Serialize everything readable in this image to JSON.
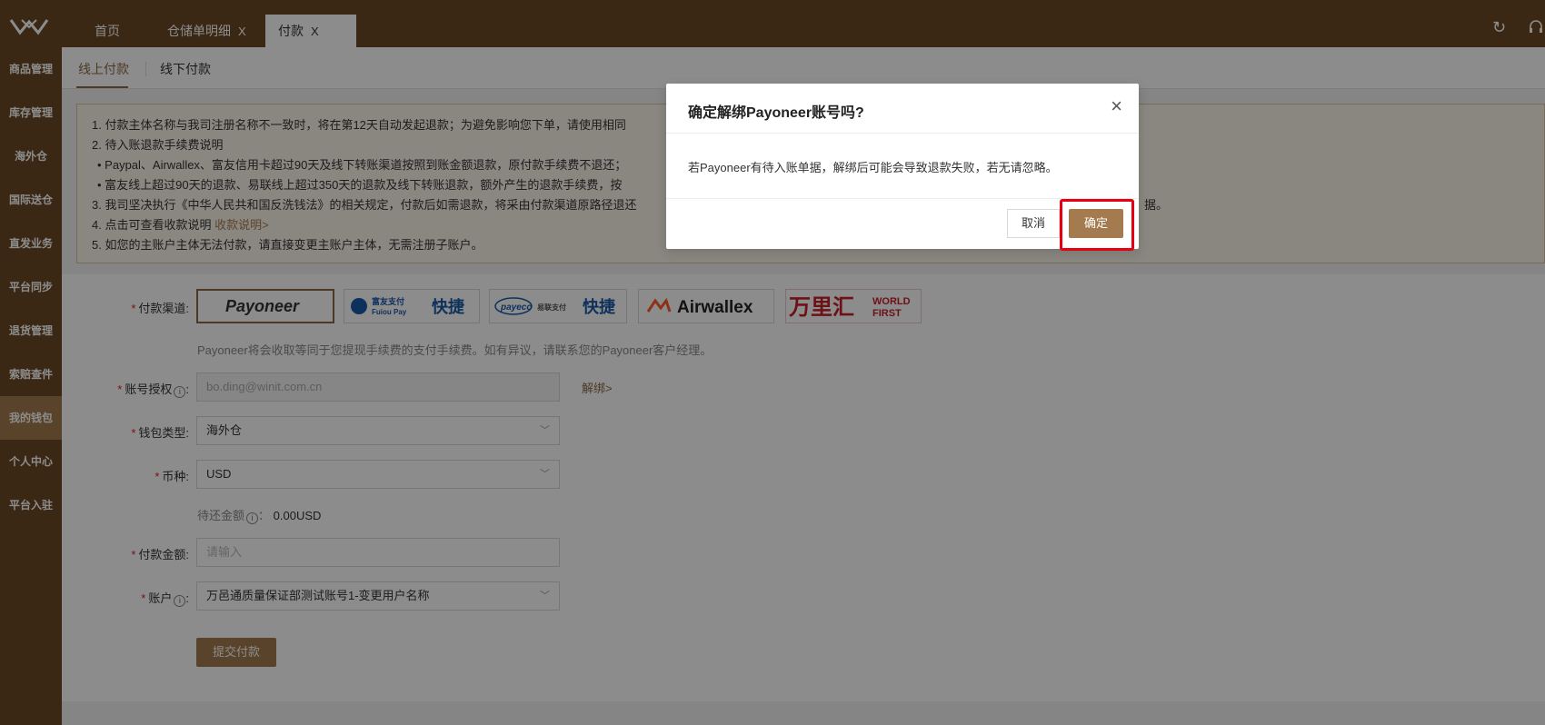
{
  "tabs": [
    {
      "label": "首页"
    },
    {
      "label": "仓储单明细",
      "close": "X"
    },
    {
      "label": "付款",
      "close": "X"
    }
  ],
  "top_icons": {
    "refresh": "refresh-icon",
    "headset": "headset-icon"
  },
  "sidebar": {
    "items": [
      {
        "label": "商品管理"
      },
      {
        "label": "库存管理"
      },
      {
        "label": "海外仓"
      },
      {
        "label": "国际送仓"
      },
      {
        "label": "直发业务"
      },
      {
        "label": "平台同步"
      },
      {
        "label": "退货管理"
      },
      {
        "label": "索赔查件"
      },
      {
        "label": "我的钱包",
        "active": true
      },
      {
        "label": "个人中心"
      },
      {
        "label": "平台入驻"
      }
    ]
  },
  "subtabs": {
    "online": "线上付款",
    "offline": "线下付款"
  },
  "notice": {
    "line1": "1. 付款主体名称与我司注册名称不一致时，将在第12天自动发起退款；为避免影响您下单，请使用相同",
    "line2": "2. 待入账退款手续费说明",
    "line3": "Paypal、Airwallex、富友信用卡超过90天及线下转账渠道按照到账金额退款，原付款手续费不退还；",
    "line4": "富友线上超过90天的退款、易联线上超过350天的退款及线下转账退款，额外产生的退款手续费，按",
    "line5": "3. 我司坚决执行《中华人民共和国反洗钱法》的相关规定，付款后如需退款，将采由付款渠道原路径退还",
    "line5_tail": "据。",
    "line6_prefix": "4. 点击可查看收款说明",
    "line6_link": "收款说明>",
    "line7": "5. 如您的主账户主体无法付款，请直接变更主账户主体，无需注册子账户。"
  },
  "form": {
    "channel_label": "付款渠道:",
    "channels": [
      {
        "name": "Payoneer"
      },
      {
        "name": "富友支付 Fuiou Pay 快捷"
      },
      {
        "name": "payeco 易联支付 快捷"
      },
      {
        "name": "Airwallex"
      },
      {
        "name": "万里汇 WORLD FIRST"
      }
    ],
    "channel_hint": "Payoneer将会收取等同于您提现手续费的支付手续费。如有异议，请联系您的Payoneer客户经理。",
    "account_auth_label": "账号授权",
    "account_auth_value": "bo.ding@winit.com.cn",
    "unbind_link": "解绑>",
    "wallet_type_label": "钱包类型:",
    "wallet_type_value": "海外仓",
    "currency_label": "币种:",
    "currency_value": "USD",
    "pending_label": "待还金额",
    "pending_value": "0.00USD",
    "amount_label": "付款金额:",
    "amount_placeholder": "请输入",
    "account_label": "账户",
    "account_value": "万邑通质量保证部测试账号1-变更用户名称",
    "submit": "提交付款"
  },
  "modal": {
    "title": "确定解绑Payoneer账号吗?",
    "body": "若Payoneer有待入账单据，解绑后可能会导致退款失败，若无请忽略。",
    "cancel": "取消",
    "ok": "确定"
  }
}
